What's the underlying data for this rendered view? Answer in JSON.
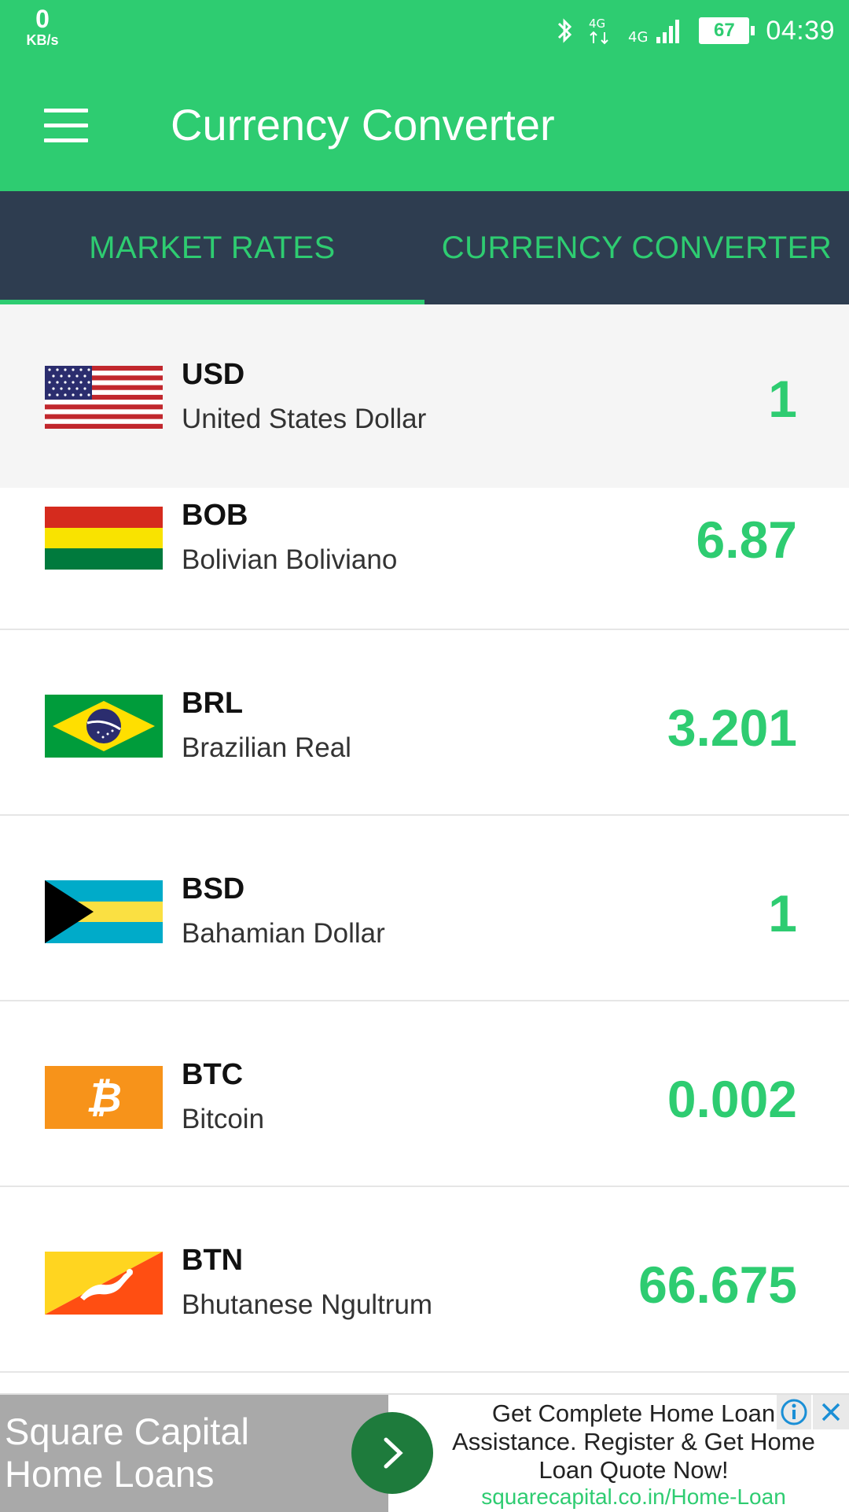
{
  "status_bar": {
    "speed_value": "0",
    "speed_unit": "KB/s",
    "network_label_1": "4G",
    "network_label_2": "4G",
    "battery": "67",
    "time": "04:39",
    "icons": [
      "bluetooth-icon",
      "data-4g-icon",
      "signal-icon",
      "battery-icon"
    ]
  },
  "app_bar": {
    "title": "Currency Converter",
    "menu_icon": "hamburger-menu-icon",
    "background": "#2ecc71"
  },
  "tabs": [
    {
      "label": "MARKET RATES",
      "selected": true
    },
    {
      "label": "CURRENCY CONVERTER",
      "selected": false
    }
  ],
  "colors": {
    "accent": "#2ecc71",
    "tab_bar": "#2e3d50",
    "selected_row": "#f5f5f5"
  },
  "currencies": [
    {
      "code": "USD",
      "name": "United States Dollar",
      "rate": "1",
      "flag": "us-flag"
    },
    {
      "code": "BOB",
      "name": "Bolivian Boliviano",
      "rate": "6.87",
      "flag": "bolivia-flag"
    },
    {
      "code": "BRL",
      "name": "Brazilian Real",
      "rate": "3.201",
      "flag": "brazil-flag"
    },
    {
      "code": "BSD",
      "name": "Bahamian Dollar",
      "rate": "1",
      "flag": "bahamas-flag"
    },
    {
      "code": "BTC",
      "name": "Bitcoin",
      "rate": "0.002",
      "flag": "bitcoin-icon"
    },
    {
      "code": "BTN",
      "name": "Bhutanese Ngultrum",
      "rate": "66.675",
      "flag": "bhutan-flag"
    }
  ],
  "ad": {
    "title_line1": "Square Capital",
    "title_line2": "Home Loans",
    "body": "Get Complete Home Loan Assistance. Register & Get Home Loan Quote Now!",
    "url": "squarecapital.co.in/Home-Loan",
    "info_icon": "info-icon",
    "close_icon": "close-icon",
    "arrow_icon": "chevron-right-icon"
  }
}
